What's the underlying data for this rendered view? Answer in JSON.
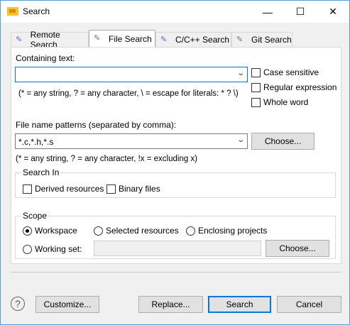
{
  "window": {
    "title": "Search",
    "minimize_glyph": "—",
    "maximize_glyph": "☐",
    "close_glyph": "✕"
  },
  "tabs": [
    {
      "label": "Remote Search",
      "icon": "remote-search-icon",
      "glyph": "✎"
    },
    {
      "label": "File Search",
      "icon": "file-search-icon",
      "glyph": "✎"
    },
    {
      "label": "C/C++ Search",
      "icon": "cpp-search-icon",
      "glyph": "✎"
    },
    {
      "label": "Git Search",
      "icon": "git-search-icon",
      "glyph": "✎"
    }
  ],
  "active_tab": "File Search",
  "containing_text": {
    "label": "Containing text:",
    "value": "",
    "hint": "(* = any string, ? = any character, \\ = escape for literals: * ? \\)",
    "case_sensitive": {
      "label": "Case sensitive",
      "checked": false
    },
    "regular_expression": {
      "label": "Regular expression",
      "checked": false
    },
    "whole_word": {
      "label": "Whole word",
      "checked": false
    }
  },
  "file_patterns": {
    "label": "File name patterns (separated by comma):",
    "value": "*.c,*.h,*.s",
    "hint": "(* = any string, ? = any character, !x = excluding x)",
    "choose_label": "Choose..."
  },
  "search_in": {
    "legend": "Search In",
    "derived": {
      "label": "Derived resources",
      "checked": false
    },
    "binary": {
      "label": "Binary files",
      "checked": false
    }
  },
  "scope": {
    "legend": "Scope",
    "selected": "Workspace",
    "workspace": "Workspace",
    "selected_resources": "Selected resources",
    "enclosing_projects": "Enclosing projects",
    "working_set": "Working set:",
    "working_set_value": "",
    "choose_label": "Choose..."
  },
  "footer": {
    "help": "?",
    "customize": "Customize...",
    "replace": "Replace...",
    "search": "Search",
    "cancel": "Cancel"
  },
  "colors": {
    "accent": "#0078d7"
  }
}
